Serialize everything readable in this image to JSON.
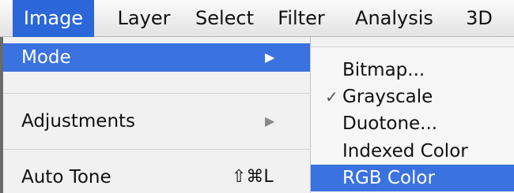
{
  "menubar": {
    "items": [
      {
        "label": "Image"
      },
      {
        "label": "Layer"
      },
      {
        "label": "Select"
      },
      {
        "label": "Filter"
      },
      {
        "label": "Analysis"
      },
      {
        "label": "3D"
      }
    ]
  },
  "image_menu": {
    "items": [
      {
        "label": "Mode",
        "submenu_indicator": "▶"
      },
      {
        "label": "Adjustments",
        "submenu_indicator": "▶"
      },
      {
        "label": "Auto Tone",
        "shortcut": "⇧⌘L"
      }
    ]
  },
  "mode_submenu": {
    "items": [
      {
        "label": "Bitmap..."
      },
      {
        "label": "Grayscale",
        "checkmark": "✓"
      },
      {
        "label": "Duotone..."
      },
      {
        "label": "Indexed Color"
      },
      {
        "label": "RGB Color"
      }
    ]
  }
}
